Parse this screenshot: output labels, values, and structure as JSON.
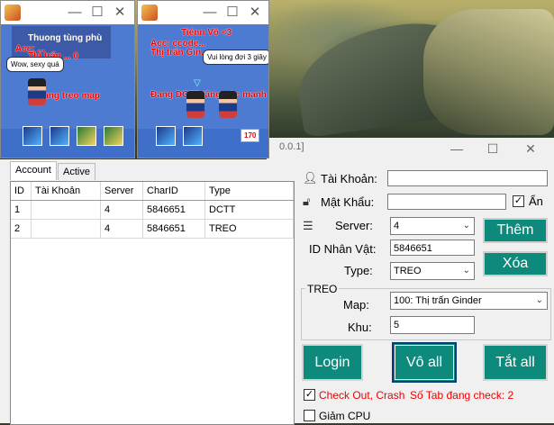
{
  "game_windows": [
    {
      "lines": [
        "Thuong tùng phù",
        "Acc: ...",
        "Thị trấn ... 0"
      ],
      "bubble": "Wow, sexy quá",
      "status": "Đang treo map"
    },
    {
      "lines": [
        "Tiénn Vô <3",
        "Acc: ccode...",
        "Thị trấn Gin..."
      ],
      "bubble": "Vui lòng đợi 3 giây",
      "status": "Đang DCTT tăng sức mạnh",
      "hp": "170"
    }
  ],
  "tool": {
    "title": "0.0.1]",
    "tabs": [
      "Account",
      "Active"
    ],
    "grid": {
      "columns": [
        "ID",
        "Tài Khoản",
        "Server",
        "CharID",
        "Type"
      ],
      "rows": [
        [
          "1",
          "",
          "4",
          "5846651",
          "DCTT"
        ],
        [
          "2",
          "",
          "4",
          "5846651",
          "TREO"
        ]
      ]
    },
    "form": {
      "account_label": "Tài Khoản:",
      "account_value": "",
      "password_label": "Mật Khẩu:",
      "password_value": "",
      "hide_label": "Ẩn",
      "hide_checked": true,
      "server_label": "Server:",
      "server_value": "4",
      "charid_label": "ID Nhân Vật:",
      "charid_value": "5846651",
      "type_label": "Type:",
      "type_value": "TREO",
      "group_title": "TREO",
      "map_label": "Map:",
      "map_value": "100: Thị trấn Ginder",
      "zone_label": "Khu:",
      "zone_value": "5"
    },
    "buttons": {
      "add": "Thêm",
      "delete": "Xóa",
      "login": "Login",
      "enter_all": "Vô all",
      "close_all": "Tắt all"
    },
    "checkout_label": "Check Out, Crash",
    "checkout_checked": true,
    "tab_count_text": "Số Tab đang check: 2",
    "reduce_cpu_label": "Giảm CPU",
    "reduce_cpu_checked": false
  },
  "colors": {
    "accent": "#0e8a7c",
    "alert": "#e00000"
  }
}
